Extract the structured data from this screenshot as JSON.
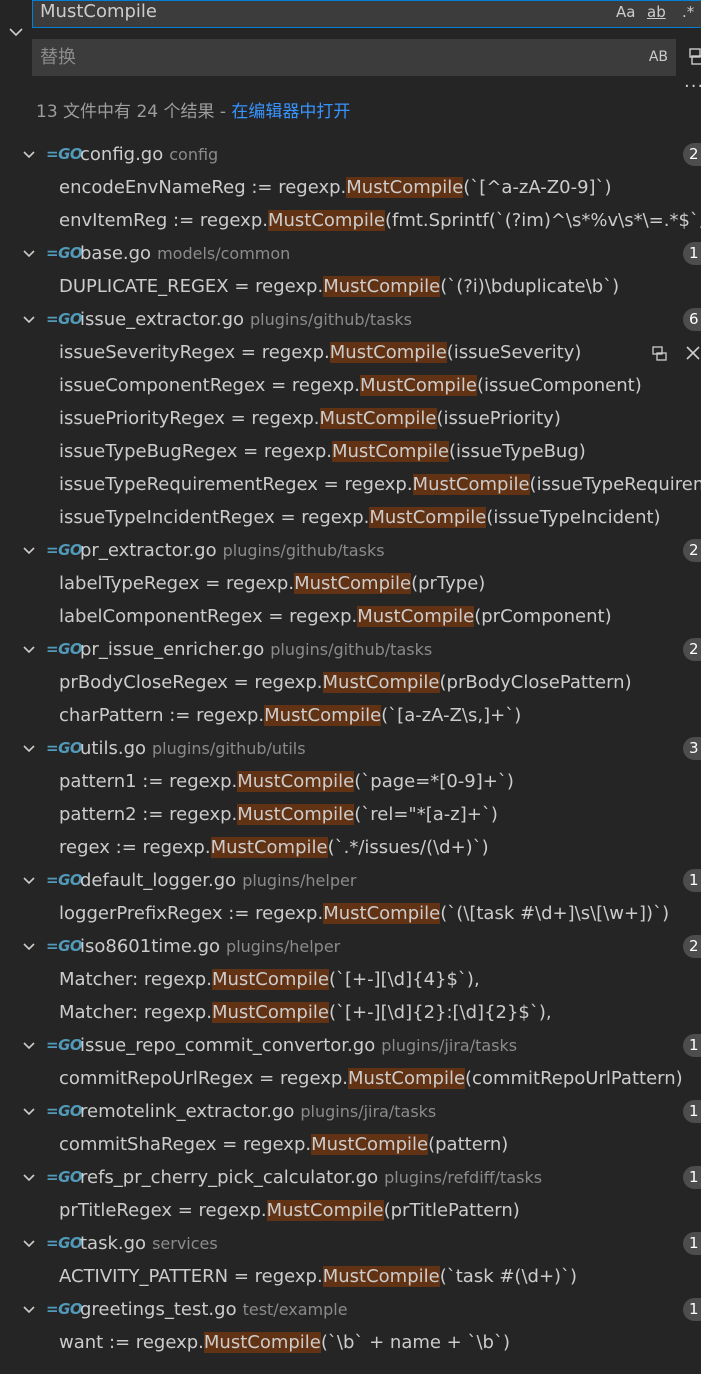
{
  "search": {
    "query": "MustCompile",
    "match_case_label": "Aa",
    "whole_word_label": "ab",
    "regex_label": ".*"
  },
  "replace": {
    "placeholder": "替换",
    "preserve_case_label": "AB"
  },
  "summary": {
    "text": "13 文件中有 24 个结果 - ",
    "open_in_editor_label": "在编辑器中打开"
  },
  "icons": {
    "file_icon_label": "GO",
    "accent": "#519aba",
    "highlight": "#613214",
    "link": "#3794ff"
  },
  "results": [
    {
      "file": "config.go",
      "path": "config",
      "count": "2",
      "matches": [
        {
          "before": "encodeEnvNameReg := regexp.",
          "match": "MustCompile",
          "after": "(`[^a-zA-Z0-9]`)"
        },
        {
          "before": "envItemReg := regexp.",
          "match": "MustCompile",
          "after": "(fmt.Sprintf(`(?im)^\\s*%v\\s*\\=.*$`, enco"
        }
      ]
    },
    {
      "file": "base.go",
      "path": "models/common",
      "count": "1",
      "matches": [
        {
          "before": "DUPLICATE_REGEX = regexp.",
          "match": "MustCompile",
          "after": "(`(?i)\\bduplicate\\b`)"
        }
      ]
    },
    {
      "file": "issue_extractor.go",
      "path": "plugins/github/tasks",
      "count": "6",
      "matches": [
        {
          "before": "issueSeverityRegex = regexp.",
          "match": "MustCompile",
          "after": "(issueSeverity)"
        },
        {
          "before": "issueComponentRegex = regexp.",
          "match": "MustCompile",
          "after": "(issueComponent)"
        },
        {
          "before": "issuePriorityRegex = regexp.",
          "match": "MustCompile",
          "after": "(issuePriority)"
        },
        {
          "before": "issueTypeBugRegex = regexp.",
          "match": "MustCompile",
          "after": "(issueTypeBug)"
        },
        {
          "before": "issueTypeRequirementRegex = regexp.",
          "match": "MustCompile",
          "after": "(issueTypeRequirement"
        },
        {
          "before": "issueTypeIncidentRegex = regexp.",
          "match": "MustCompile",
          "after": "(issueTypeIncident)"
        }
      ]
    },
    {
      "file": "pr_extractor.go",
      "path": "plugins/github/tasks",
      "count": "2",
      "matches": [
        {
          "before": "labelTypeRegex = regexp.",
          "match": "MustCompile",
          "after": "(prType)"
        },
        {
          "before": "labelComponentRegex = regexp.",
          "match": "MustCompile",
          "after": "(prComponent)"
        }
      ]
    },
    {
      "file": "pr_issue_enricher.go",
      "path": "plugins/github/tasks",
      "count": "2",
      "matches": [
        {
          "before": "prBodyCloseRegex = regexp.",
          "match": "MustCompile",
          "after": "(prBodyClosePattern)"
        },
        {
          "before": "charPattern := regexp.",
          "match": "MustCompile",
          "after": "(`[a-zA-Z\\s,]+`)"
        }
      ]
    },
    {
      "file": "utils.go",
      "path": "plugins/github/utils",
      "count": "3",
      "matches": [
        {
          "before": "pattern1 := regexp.",
          "match": "MustCompile",
          "after": "(`page=*[0-9]+`)"
        },
        {
          "before": "pattern2 := regexp.",
          "match": "MustCompile",
          "after": "(`rel=\"*[a-z]+`)"
        },
        {
          "before": "regex := regexp.",
          "match": "MustCompile",
          "after": "(`.*/issues/(\\d+)`)"
        }
      ]
    },
    {
      "file": "default_logger.go",
      "path": "plugins/helper",
      "count": "1",
      "matches": [
        {
          "before": "loggerPrefixRegex := regexp.",
          "match": "MustCompile",
          "after": "(`(\\[task #\\d+]\\s\\[\\w+])`)"
        }
      ]
    },
    {
      "file": "iso8601time.go",
      "path": "plugins/helper",
      "count": "2",
      "matches": [
        {
          "before": "Matcher: regexp.",
          "match": "MustCompile",
          "after": "(`[+-][\\d]{4}$`),"
        },
        {
          "before": "Matcher: regexp.",
          "match": "MustCompile",
          "after": "(`[+-][\\d]{2}:[\\d]{2}$`),"
        }
      ]
    },
    {
      "file": "issue_repo_commit_convertor.go",
      "path": "plugins/jira/tasks",
      "count": "1",
      "matches": [
        {
          "before": "commitRepoUrlRegex = regexp.",
          "match": "MustCompile",
          "after": "(commitRepoUrlPattern)"
        }
      ]
    },
    {
      "file": "remotelink_extractor.go",
      "path": "plugins/jira/tasks",
      "count": "1",
      "matches": [
        {
          "before": "commitShaRegex = regexp.",
          "match": "MustCompile",
          "after": "(pattern)"
        }
      ]
    },
    {
      "file": "refs_pr_cherry_pick_calculator.go",
      "path": "plugins/refdiff/tasks",
      "count": "1",
      "matches": [
        {
          "before": "prTitleRegex = regexp.",
          "match": "MustCompile",
          "after": "(prTitlePattern)"
        }
      ]
    },
    {
      "file": "task.go",
      "path": "services",
      "count": "1",
      "matches": [
        {
          "before": "ACTIVITY_PATTERN = regexp.",
          "match": "MustCompile",
          "after": "(`task #(\\d+)`)"
        }
      ]
    },
    {
      "file": "greetings_test.go",
      "path": "test/example",
      "count": "1",
      "matches": [
        {
          "before": "want := regexp.",
          "match": "MustCompile",
          "after": "(`\\b` + name + `\\b`)"
        }
      ]
    }
  ]
}
